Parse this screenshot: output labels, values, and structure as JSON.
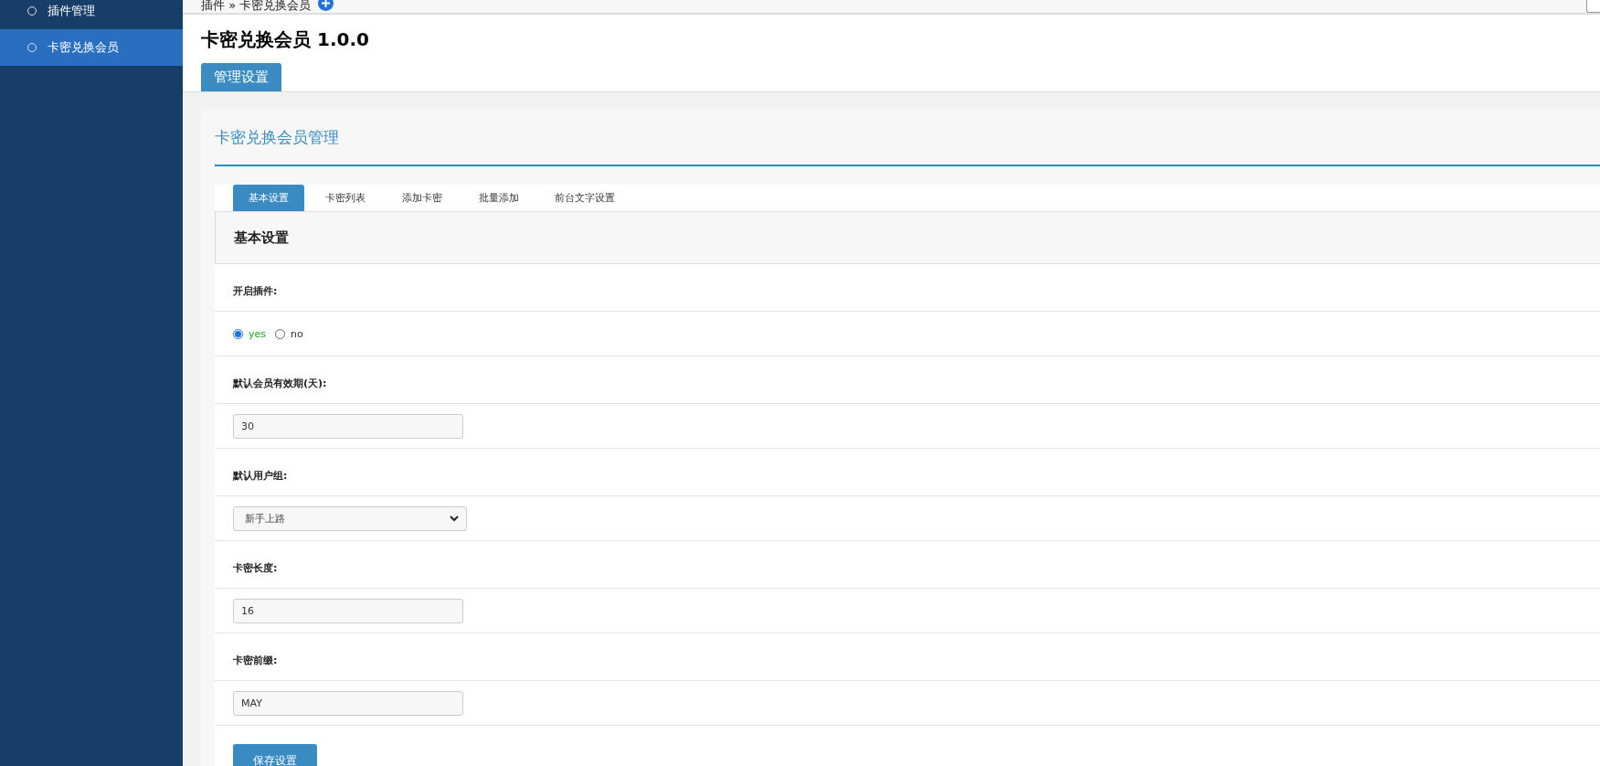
{
  "sidebar": {
    "items": [
      {
        "label": "插件管理",
        "selected": false
      },
      {
        "label": "卡密兑换会员",
        "selected": true
      }
    ]
  },
  "breadcrumb": {
    "text": "插件 » 卡密兑换会员"
  },
  "page": {
    "title": "卡密兑换会员 1.0.0",
    "tabs": [
      {
        "label": "管理设置",
        "selected": true
      }
    ]
  },
  "card": {
    "title": "卡密兑换会员管理",
    "tabs": [
      {
        "label": "基本设置",
        "selected": true
      },
      {
        "label": "卡密列表",
        "selected": false
      },
      {
        "label": "添加卡密",
        "selected": false
      },
      {
        "label": "批量添加",
        "selected": false
      },
      {
        "label": "前台文字设置",
        "selected": false
      }
    ],
    "section_title": "基本设置",
    "fields": [
      {
        "kind": "radio",
        "label": "开启插件:",
        "options": [
          {
            "label": "yes",
            "selected": true
          },
          {
            "label": "no",
            "selected": false
          }
        ]
      },
      {
        "kind": "text",
        "label": "默认会员有效期(天):",
        "value": "30"
      },
      {
        "kind": "select",
        "label": "默认用户组:",
        "value": "新手上路"
      },
      {
        "kind": "text",
        "label": "卡密长度:",
        "value": "16"
      },
      {
        "kind": "text",
        "label": "卡密前缀:",
        "value": "MAY"
      }
    ],
    "save_button": "保存设置"
  }
}
